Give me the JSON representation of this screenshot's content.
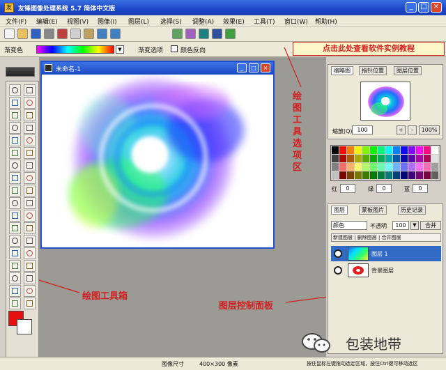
{
  "window": {
    "title": "友锋图像处理系统 5.7 简体中文版",
    "icon_text": "友"
  },
  "menu": [
    "文件(F)",
    "编辑(E)",
    "视图(V)",
    "图像(I)",
    "图层(L)",
    "选择(S)",
    "调整(A)",
    "效果(E)",
    "工具(T)",
    "窗口(W)",
    "帮助(H)"
  ],
  "toolbar_icons": [
    "new-icon",
    "open-icon",
    "save-icon",
    "print-icon",
    "cut-icon",
    "copy-icon",
    "paste-icon",
    "undo-icon",
    "redo-icon",
    "zoom-icon",
    "filter-icon",
    "effect-icon",
    "layer-icon",
    "help-icon"
  ],
  "options": {
    "gradient_label": "渐变色",
    "style_label": "渐变选项",
    "checkbox_label": "颜色反向",
    "gradient_colors": [
      "#ff00ff",
      "#0000ff",
      "#00ffff",
      "#00ff00",
      "#ffff00",
      "#ff0000"
    ]
  },
  "banner": "点击此处查看软件实例教程",
  "document": {
    "title": "未命名-1"
  },
  "annotations": {
    "options_area": "绘图工具选项区",
    "toolbox": "绘图工具箱",
    "layers_panel": "图层控制面板"
  },
  "navigator": {
    "tabs": [
      "缩略图",
      "指针位置",
      "图层位置"
    ],
    "zoom_label": "缩放(Q)",
    "zoom_value": "100",
    "zoom_reset": "100%"
  },
  "color": {
    "foreground": "#e61010",
    "background": "#ffffff",
    "r_label": "红",
    "r_value": "0",
    "g_label": "绿",
    "g_value": "0",
    "b_label": "蓝",
    "b_value": "0"
  },
  "layers": {
    "tabs": [
      "图层",
      "蒙板图片",
      "历史记录"
    ],
    "blend_mode": "颜色",
    "opacity_label": "不透明",
    "opacity_value": "100",
    "merge_label": "合并",
    "actions": "新建图层 | 删除图层 | 合并图层",
    "items": [
      {
        "name": "图层 1"
      },
      {
        "name": "背景图层"
      }
    ]
  },
  "status": {
    "size_label": "图像尺寸",
    "size_value": "400×300 像素",
    "hint": "按住鼠标左键拖动选定区域，按住Ctrl键可移动选区"
  },
  "watermark": {
    "text": "包装地带"
  }
}
